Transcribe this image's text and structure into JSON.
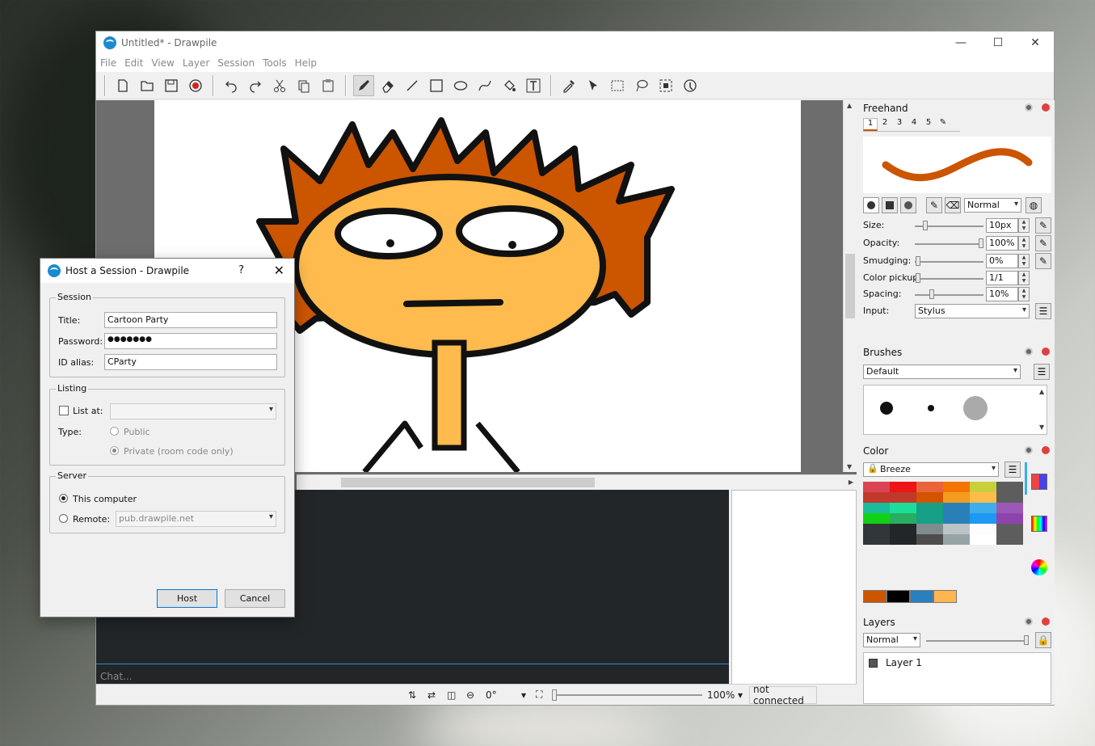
{
  "window": {
    "title": "Untitled* - Drawpile"
  },
  "menu": [
    "File",
    "Edit",
    "View",
    "Layer",
    "Session",
    "Tools",
    "Help"
  ],
  "chat": {
    "placeholder": "Chat..."
  },
  "status": {
    "rotation": "0°",
    "zoom": "100%",
    "connection": "not connected"
  },
  "freehand": {
    "title": "Freehand",
    "presets": [
      "1",
      "2",
      "3",
      "4",
      "5"
    ],
    "blend_mode": "Normal",
    "size_label": "Size:",
    "size": "10px",
    "opacity_label": "Opacity:",
    "opacity": "100%",
    "smudging_label": "Smudging:",
    "smudging": "0%",
    "pickup_label": "Color pickup:",
    "pickup": "1/1",
    "spacing_label": "Spacing:",
    "spacing": "10%",
    "input_label": "Input:",
    "input": "Stylus",
    "brush_color": "#cc5500"
  },
  "brushes": {
    "title": "Brushes",
    "preset": "Default"
  },
  "color": {
    "title": "Color",
    "palette": "Breeze",
    "swatches": [
      [
        "#da4453",
        "#ed1515",
        "#e9643a",
        "#f67400",
        "#c9ce3b",
        "#5d5d5d"
      ],
      [
        "#c0392b",
        "#c0392b",
        "#d35400",
        "#f39c1f",
        "#fdbc4b",
        "#5d5d5d"
      ],
      [
        "#1abc9c",
        "#1cdc9a",
        "#16a085",
        "#2980b9",
        "#3daee9",
        "#9b59b6"
      ],
      [
        "#11d116",
        "#27ae60",
        "#16a085",
        "#2980b9",
        "#1d99f3",
        "#8e44ad"
      ],
      [
        "#31363b",
        "#232629",
        "#7f8c8d",
        "#bdc3c7",
        "#fcfcfc",
        "#5d5d5d"
      ],
      [
        "#31363b",
        "#232629",
        "#4d4d4d",
        "#95a5a6",
        "#ffffff",
        "#5d5d5d"
      ]
    ],
    "recent": [
      "#cc5500",
      "#000000",
      "#2a7fbf",
      "#ffb74d"
    ]
  },
  "layers": {
    "title": "Layers",
    "blend_mode": "Normal",
    "items": [
      "Layer 1"
    ]
  },
  "dialog": {
    "title": "Host a Session - Drawpile",
    "help_glyph": "?",
    "session_legend": "Session",
    "title_label": "Title:",
    "title_value": "Cartoon Party",
    "password_label": "Password:",
    "password_value": "●●●●●●●",
    "alias_label": "ID alias:",
    "alias_value": "CParty",
    "listing_legend": "Listing",
    "list_at_label": "List at:",
    "type_label": "Type:",
    "public_label": "Public",
    "private_label": "Private (room code only)",
    "server_legend": "Server",
    "this_computer_label": "This computer",
    "remote_label": "Remote:",
    "remote_value": "pub.drawpile.net",
    "host_button": "Host",
    "cancel_button": "Cancel"
  }
}
